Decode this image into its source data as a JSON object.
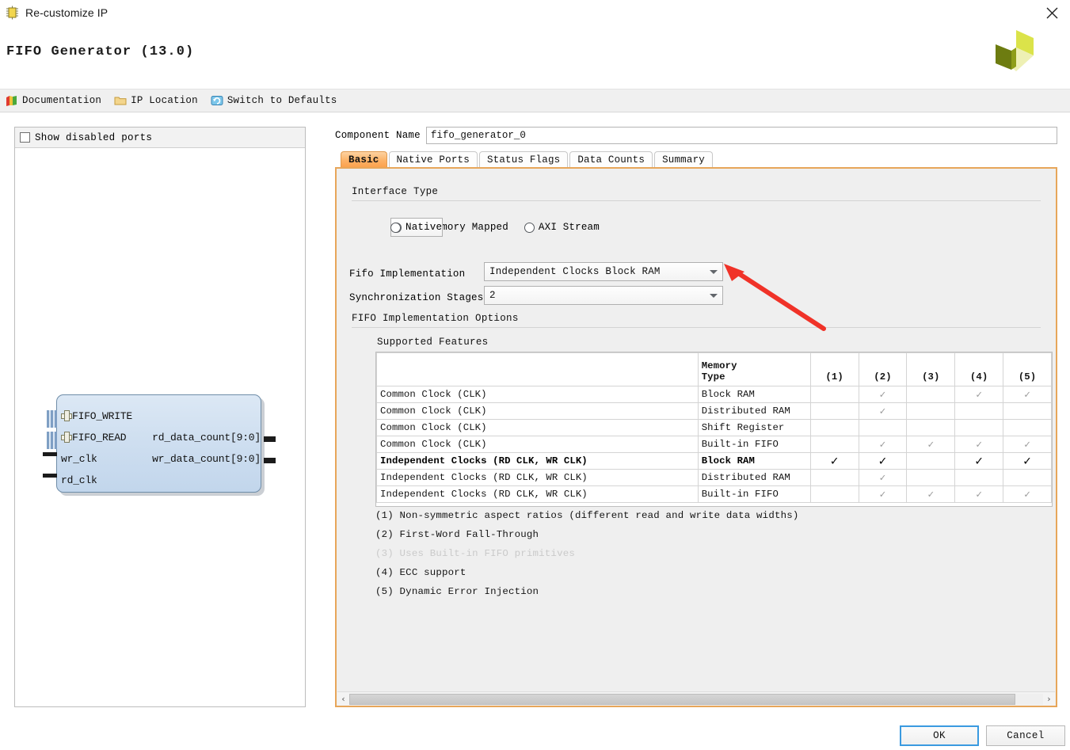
{
  "window": {
    "title": "Re-customize IP",
    "icon": "ip-chip-icon",
    "close_label": "close-icon"
  },
  "header": {
    "ip_title": "FIFO Generator (13.0)",
    "logo": "xilinx-logo"
  },
  "toolbar": {
    "items": [
      {
        "label": "Documentation",
        "icon": "documentation-book-icon"
      },
      {
        "label": "IP Location",
        "icon": "folder-icon"
      },
      {
        "label": "Switch to Defaults",
        "icon": "refresh-defaults-icon"
      }
    ]
  },
  "left_panel": {
    "show_disabled_ports_label": "Show disabled ports",
    "show_disabled_ports_checked": false,
    "symbol": {
      "ports_left_bus": [
        "FIFO_WRITE",
        "FIFO_READ"
      ],
      "ports_left_clk": [
        "wr_clk",
        "rd_clk"
      ],
      "ports_right": [
        "rd_data_count[9:0]",
        "wr_data_count[9:0]"
      ]
    }
  },
  "component": {
    "name_label": "Component Name",
    "name_value": "fifo_generator_0",
    "name_placeholder": "fifo_generator_0"
  },
  "tabs": [
    {
      "label": "Basic",
      "active": true
    },
    {
      "label": "Native Ports",
      "active": false
    },
    {
      "label": "Status Flags",
      "active": false
    },
    {
      "label": "Data Counts",
      "active": false
    },
    {
      "label": "Summary",
      "active": false
    }
  ],
  "panel": {
    "interface_type_title": "Interface Type",
    "interface_options": [
      {
        "label": "Native",
        "selected": true
      },
      {
        "label": "AXI Memory Mapped",
        "selected": false
      },
      {
        "label": "AXI Stream",
        "selected": false
      }
    ],
    "fifo_implementation_label": "Fifo Implementation",
    "fifo_implementation_value": "Independent Clocks Block RAM",
    "sync_stages_label": "Synchronization Stages",
    "sync_stages_value": "2",
    "fifo_impl_options_title": "FIFO Implementation Options",
    "supported_features_title": "Supported Features"
  },
  "feature_table": {
    "headers": [
      "",
      "Memory\nType",
      "(1)",
      "(2)",
      "(3)",
      "(4)",
      "(5)"
    ],
    "header_memory_type_line1": "Memory",
    "header_memory_type_line2": "Type",
    "col_numbers": [
      "(1)",
      "(2)",
      "(3)",
      "(4)",
      "(5)"
    ],
    "check_glyph": "✓",
    "rows": [
      {
        "clock": "Common Clock (CLK)",
        "memory": "Block RAM",
        "checks": [
          false,
          true,
          false,
          true,
          true
        ],
        "highlight": false
      },
      {
        "clock": "Common Clock (CLK)",
        "memory": "Distributed RAM",
        "checks": [
          false,
          true,
          false,
          false,
          false
        ],
        "highlight": false
      },
      {
        "clock": "Common Clock (CLK)",
        "memory": "Shift Register",
        "checks": [
          false,
          false,
          false,
          false,
          false
        ],
        "highlight": false
      },
      {
        "clock": "Common Clock (CLK)",
        "memory": "Built-in FIFO",
        "checks": [
          false,
          true,
          true,
          true,
          true
        ],
        "highlight": false
      },
      {
        "clock": "Independent Clocks (RD CLK, WR CLK)",
        "memory": "Block RAM",
        "checks": [
          true,
          true,
          false,
          true,
          true
        ],
        "highlight": true
      },
      {
        "clock": "Independent Clocks (RD CLK, WR CLK)",
        "memory": "Distributed RAM",
        "checks": [
          false,
          true,
          false,
          false,
          false
        ],
        "highlight": false
      },
      {
        "clock": "Independent Clocks (RD CLK, WR CLK)",
        "memory": "Built-in FIFO",
        "checks": [
          false,
          true,
          true,
          true,
          true
        ],
        "highlight": false
      }
    ]
  },
  "footnotes": [
    {
      "text": "(1) Non-symmetric aspect ratios (different read and write data widths)",
      "dim": false
    },
    {
      "text": "(2) First-Word Fall-Through",
      "dim": false
    },
    {
      "text": "(3) Uses Built-in FIFO primitives",
      "dim": true
    },
    {
      "text": "(4) ECC support",
      "dim": false
    },
    {
      "text": "(5) Dynamic Error Injection",
      "dim": false
    }
  ],
  "scrollbar": {
    "left_arrow": "‹",
    "right_arrow": "›"
  },
  "buttons": {
    "ok": "OK",
    "cancel": "Cancel"
  },
  "colors": {
    "accent_orange": "#e7a65a",
    "tab_active": "#fcb165",
    "annotation_red": "#f03228",
    "logo_green": "#9aad24",
    "block_fill": "#cfdff0"
  }
}
